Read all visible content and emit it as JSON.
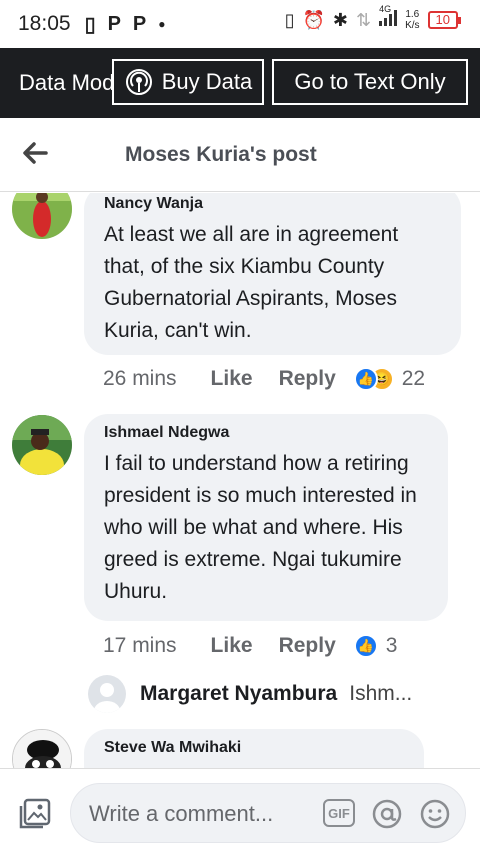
{
  "status": {
    "time": "18:05",
    "network": "4G",
    "speed_value": "1.6",
    "speed_unit": "K/s",
    "battery": "10"
  },
  "banner": {
    "mode_text": "Data Mode",
    "buy_label": "Buy Data",
    "text_only_label": "Go to Text Only"
  },
  "header": {
    "title": "Moses Kuria's post"
  },
  "comments": [
    {
      "author": "Nancy Wanja",
      "text": "At least we all are in agreement that, of the six Kiambu County Gubernatorial Aspirants, Moses Kuria, can't win.",
      "time": "26 mins",
      "like_label": "Like",
      "reply_label": "Reply",
      "reaction_count": "22",
      "reactions": [
        "like",
        "haha"
      ]
    },
    {
      "author": "Ishmael Ndegwa",
      "text": "I fail to understand how a retiring president is so much interested in who will be what and where. His greed is extreme. Ngai tukumire Uhuru.",
      "time": "17 mins",
      "like_label": "Like",
      "reply_label": "Reply",
      "reaction_count": "3",
      "reactions": [
        "like"
      ]
    },
    {
      "author": "Steve Wa Mwihaki",
      "text": ""
    }
  ],
  "reply_preview": {
    "author": "Margaret Nyambura",
    "snippet": "Ishm..."
  },
  "composer": {
    "placeholder": "Write a comment...",
    "gif_label": "GIF"
  },
  "colors": {
    "banner_bg": "#1c1e21",
    "like_blue": "#1877f2",
    "haha_yellow": "#f7b125",
    "bubble_bg": "#f0f2f5",
    "battery_red": "#dd3333"
  }
}
